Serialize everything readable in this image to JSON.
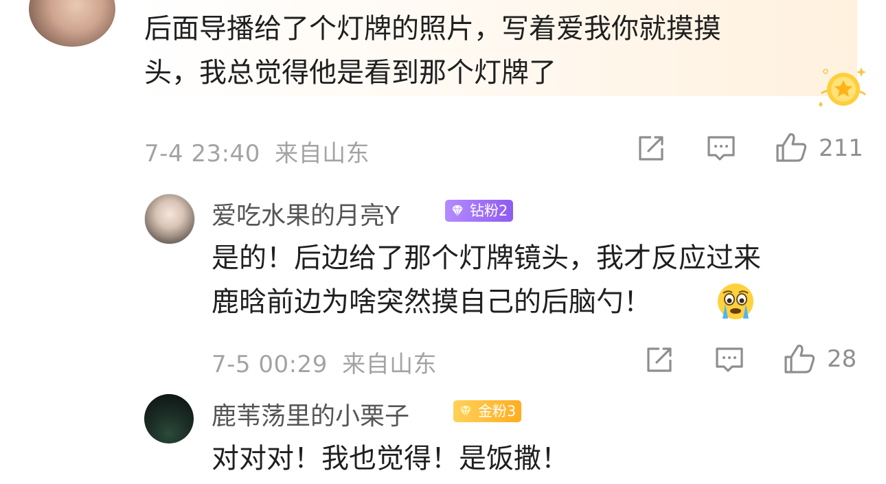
{
  "top_comment": {
    "text_line1": "后面导播给了个灯牌的照片，写着爱我你就摸摸",
    "text_line2": "头，我总觉得他是看到那个灯牌了",
    "time": "7-4 23:40",
    "location": "来自山东",
    "likes": "211"
  },
  "replies": [
    {
      "username": "爱吃水果的月亮Y",
      "badge": "钻粉2",
      "badge_color": "#9b6cf6",
      "text_line1": "是的！后边给了那个灯牌镜头，我才反应过来",
      "text_line2": "鹿晗前边为啥突然摸自己的后脑勺！",
      "emoji": "crying-face",
      "time": "7-5 00:29",
      "location": "来自山东",
      "likes": "28"
    },
    {
      "username": "鹿苇荡里的小栗子",
      "badge": "金粉3",
      "badge_color": "#ffb52a",
      "text_line1": "对对对！我也觉得！是饭撒！"
    }
  ],
  "colors": {
    "meta_gray": "#a3a3a3",
    "text": "#1f1f1f",
    "bubble_tint": "#fff1de"
  }
}
